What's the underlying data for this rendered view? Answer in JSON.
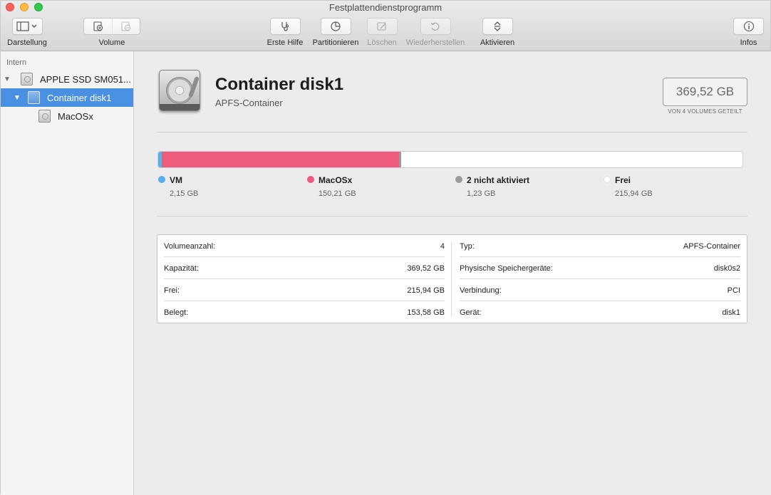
{
  "window": {
    "title": "Festplattendienstprogramm"
  },
  "toolbar": {
    "darstellung": "Darstellung",
    "volume": "Volume",
    "erste_hilfe": "Erste Hilfe",
    "partitionieren": "Partitionieren",
    "loeschen": "Löschen",
    "wiederherstellen": "Wiederherstellen",
    "aktivieren": "Aktivieren",
    "infos": "Infos"
  },
  "sidebar": {
    "section": "Intern",
    "items": [
      {
        "label": "APPLE SSD SM051..."
      },
      {
        "label": "Container disk1"
      },
      {
        "label": "MacOSx"
      }
    ]
  },
  "header": {
    "name": "Container disk1",
    "subtitle": "APFS-Container",
    "capacity": "369,52 GB",
    "capacity_note": "VON 4 VOLUMES GETEILT"
  },
  "usage": {
    "total_gb": 369.52,
    "segments": [
      {
        "name": "VM",
        "size": "2,15 GB",
        "gb": 2.15,
        "color": "#55b0ec"
      },
      {
        "name": "MacOSx",
        "size": "150,21 GB",
        "gb": 150.21,
        "color": "#ef5b7c"
      },
      {
        "name": "2 nicht aktiviert",
        "size": "1,23 GB",
        "gb": 1.23,
        "color": "#9a9a9a"
      },
      {
        "name": "Frei",
        "size": "215,94 GB",
        "gb": 215.94,
        "color": "#ffffff"
      }
    ]
  },
  "info": {
    "left": [
      {
        "label": "Volumeanzahl:",
        "value": "4"
      },
      {
        "label": "Kapazität:",
        "value": "369,52 GB"
      },
      {
        "label": "Frei:",
        "value": "215,94 GB"
      },
      {
        "label": "Belegt:",
        "value": "153,58 GB"
      }
    ],
    "right": [
      {
        "label": "Typ:",
        "value": "APFS-Container"
      },
      {
        "label": "Physische Speichergeräte:",
        "value": "disk0s2"
      },
      {
        "label": "Verbindung:",
        "value": "PCI"
      },
      {
        "label": "Gerät:",
        "value": "disk1"
      }
    ]
  }
}
